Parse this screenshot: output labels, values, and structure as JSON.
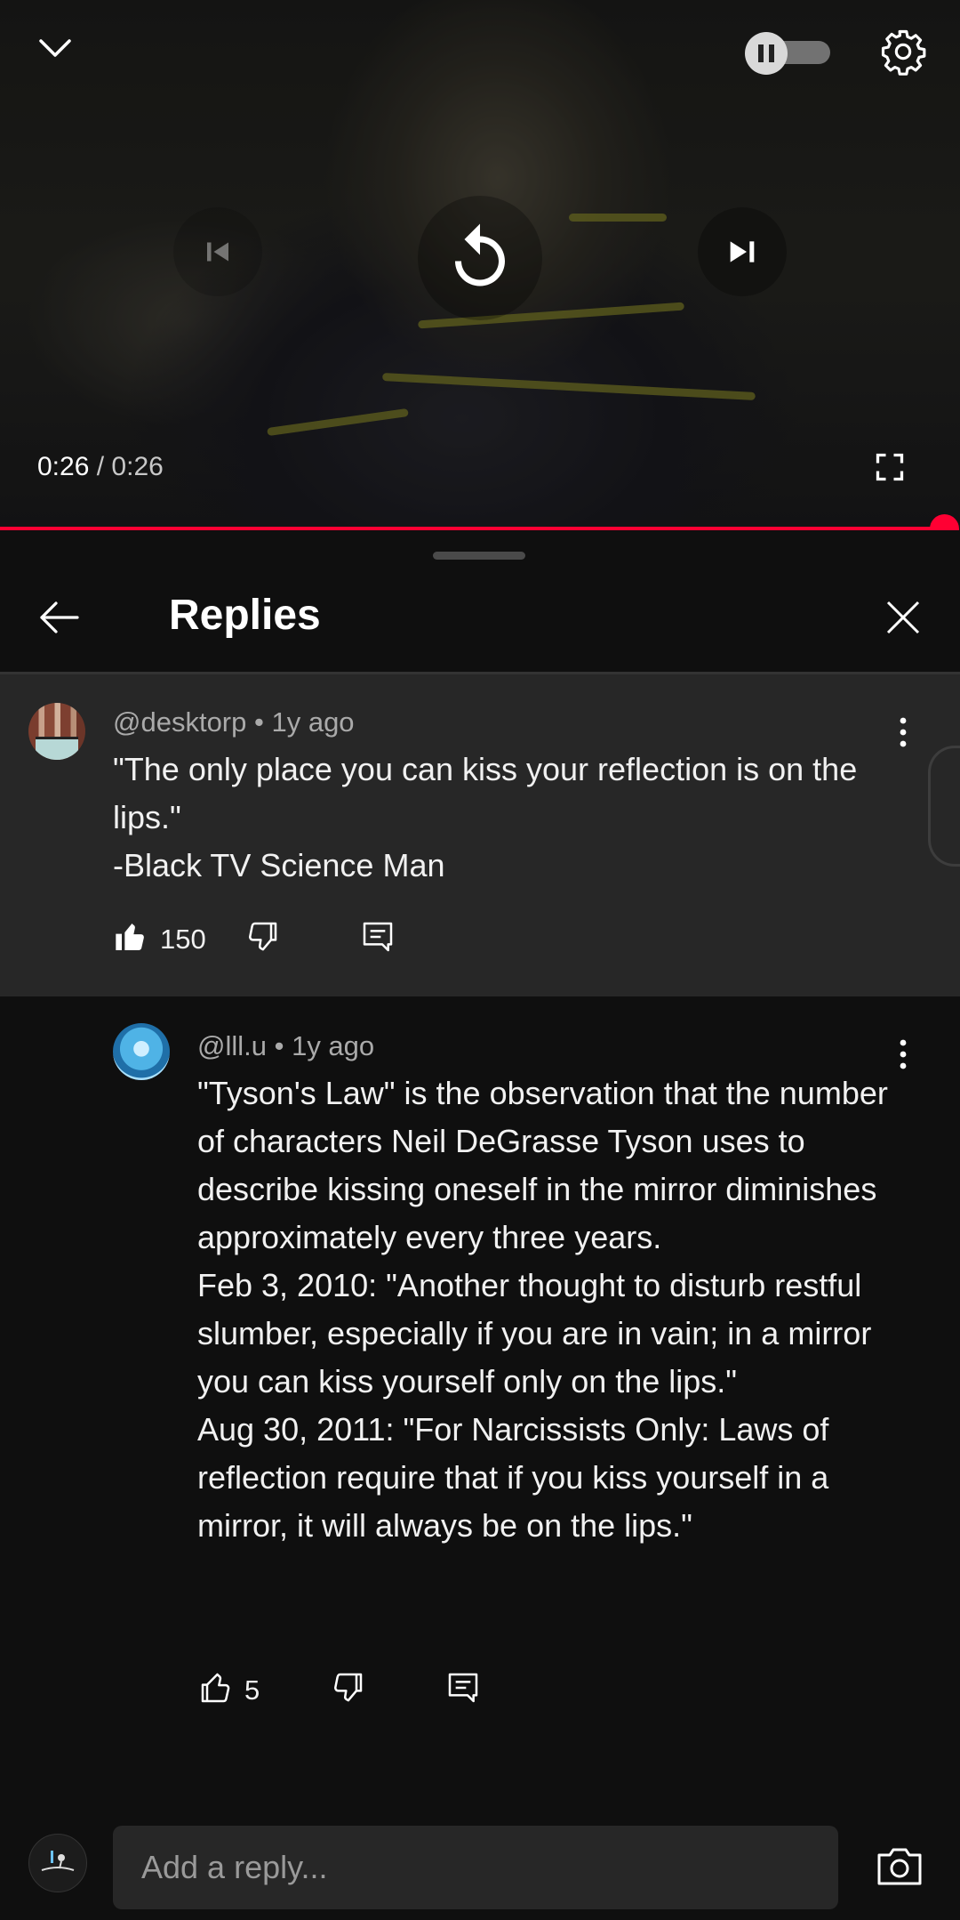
{
  "player": {
    "current_time": "0:26",
    "separator": "/",
    "duration": "0:26",
    "progress": 1.0,
    "autoplay_paused": true
  },
  "panel": {
    "title": "Replies"
  },
  "parent_comment": {
    "author": "@desktorp",
    "age": "1y ago",
    "text": "\"The only place you can kiss your reflection is on the lips.\"\n-Black TV Science Man",
    "likes": "150",
    "liked": true
  },
  "reply": {
    "author": "@lll.u",
    "age": "1y ago",
    "text": "\"Tyson's Law\" is the observation that the number of characters Neil DeGrasse Tyson uses to describe kissing oneself in the mirror diminishes approximately every three years.\nFeb 3, 2010: \"Another thought to disturb restful slumber, especially if you are in vain; in a mirror you can kiss yourself only on the lips.\"\nAug 30, 2011: \"For Narcissists Only: Laws of reflection require that if you kiss yourself in a mirror, it will always be on the lips.\"",
    "likes": "5"
  },
  "composer": {
    "placeholder": "Add a reply..."
  },
  "colors": {
    "accent": "#ff0033",
    "background": "#0f0f0f",
    "highlight": "#272727"
  }
}
